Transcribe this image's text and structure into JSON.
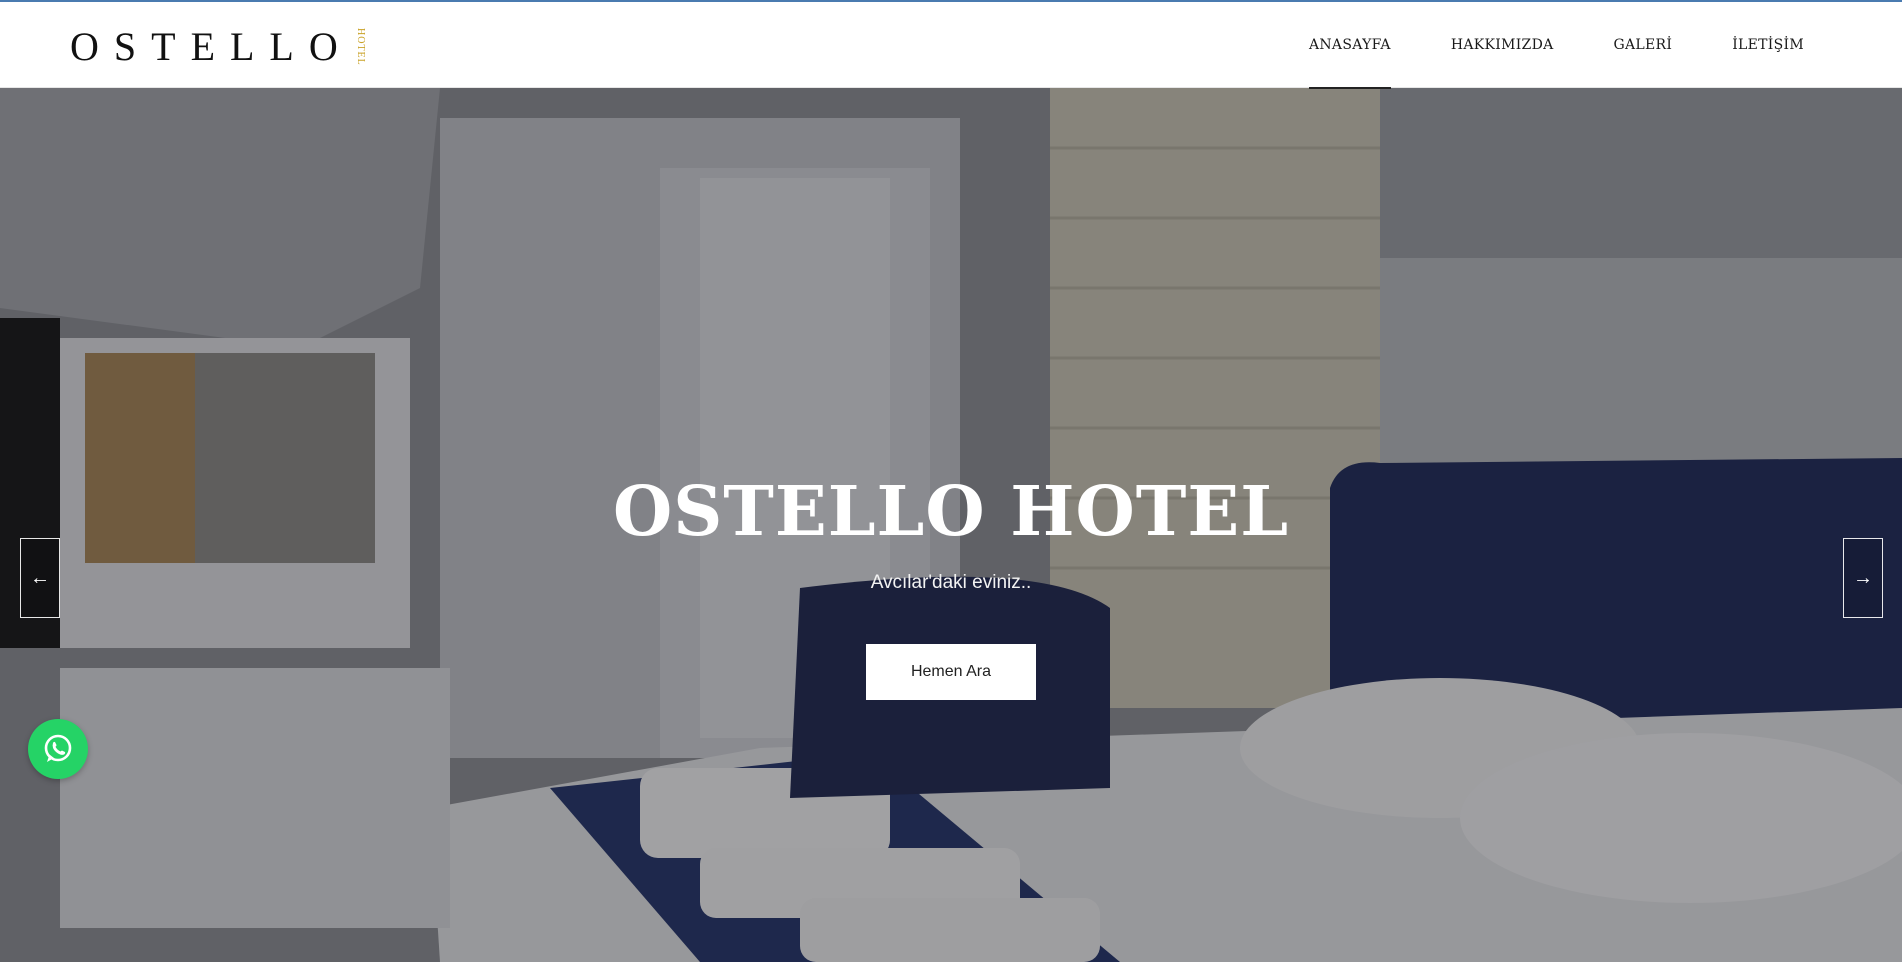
{
  "brand": {
    "logo_text": "OSTELLO",
    "logo_side_text": "HOTEL"
  },
  "nav": {
    "items": [
      {
        "label": "ANASAYFA",
        "active": true
      },
      {
        "label": "HAKKIMIZDA",
        "active": false
      },
      {
        "label": "GALERİ",
        "active": false
      },
      {
        "label": "İLETİŞİM",
        "active": false
      }
    ]
  },
  "hero": {
    "title": "OSTELLO HOTEL",
    "subtitle": "Avcılar'daki eviniz..",
    "cta_label": "Hemen Ara",
    "prev_icon": "arrow-left-icon",
    "next_icon": "arrow-right-icon"
  },
  "floating": {
    "whatsapp_icon": "whatsapp-icon"
  },
  "colors": {
    "accent": "#c9a227",
    "whatsapp": "#25d366",
    "header_border": "#4a7bb0"
  }
}
